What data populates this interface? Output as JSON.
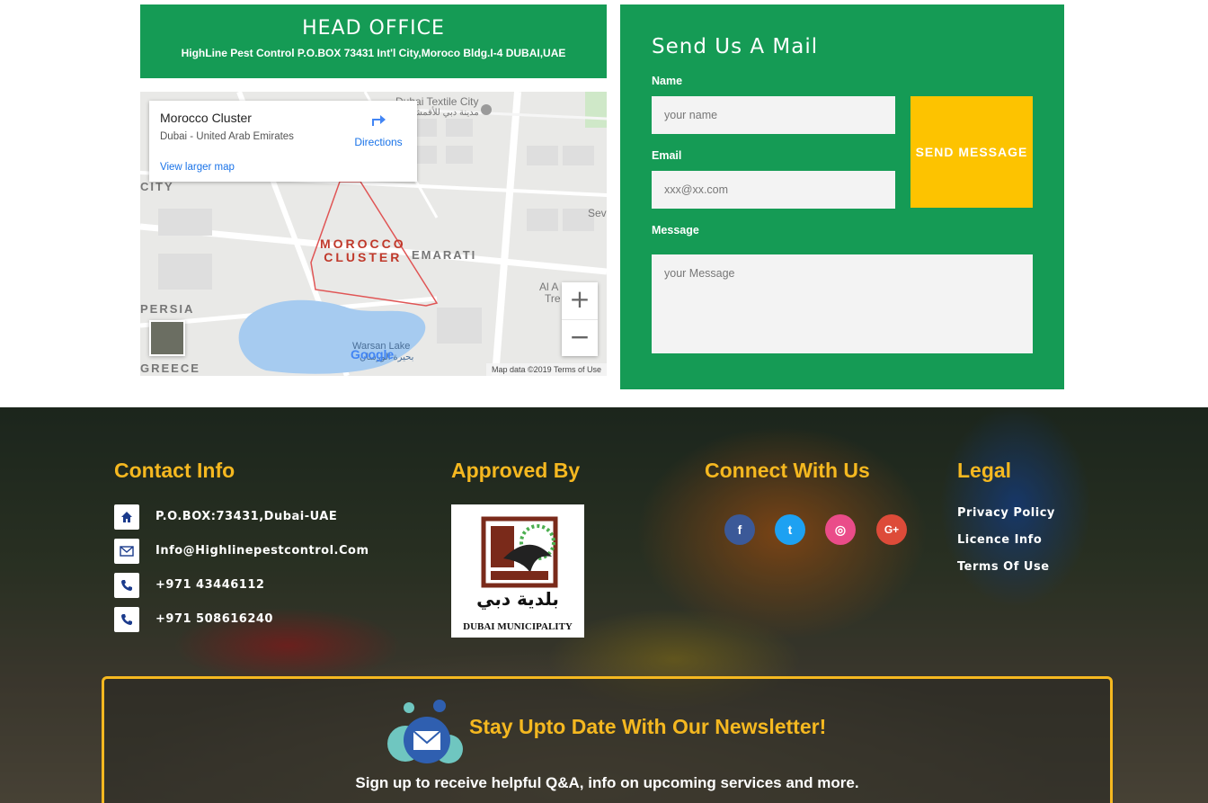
{
  "head_office": {
    "title": "HEAD OFFICE",
    "address": "HighLine Pest Control P.O.BOX 73431 Int'l City,Moroco Bldg.I-4 DUBAI,UAE"
  },
  "map": {
    "place_name": "Morocco Cluster",
    "place_sub": "Dubai - United Arab Emirates",
    "directions_label": "Directions",
    "larger_map_label": "View larger map",
    "labels": {
      "city": "CITY",
      "persia": "PERSIA",
      "greece": "GREECE",
      "emarati": "EMARATI",
      "textile": "Dubai Textile City",
      "textile_ar": "مدينة دبي للأقمشة",
      "warsan": "Warsan Lake",
      "warsan_ar": "بحيرة الورسان",
      "sev": "Sev",
      "al_a": "Al A",
      "tre": "Tre",
      "cluster_line1": "MOROCCO",
      "cluster_line2": "CLUSTER"
    },
    "zoom_in": "+",
    "zoom_out": "−",
    "google": "Google",
    "attribution": "Map data ©2019  Terms of Use"
  },
  "mail_form": {
    "title": "Send Us A Mail",
    "name_label": "Name",
    "name_placeholder": "your name",
    "email_label": "Email",
    "email_placeholder": "xxx@xx.com",
    "message_label": "Message",
    "message_placeholder": "your Message",
    "send_label": "SEND MESSAGE"
  },
  "footer": {
    "contact": {
      "heading": "Contact Info",
      "items": [
        {
          "icon": "home-icon",
          "text": "P.O.BOX:73431,Dubai-UAE"
        },
        {
          "icon": "envelope-icon",
          "text": "Info@Highlinepestcontrol.Com"
        },
        {
          "icon": "phone-icon",
          "text": "+971 43446112"
        },
        {
          "icon": "phone-icon",
          "text": "+971 508616240"
        }
      ]
    },
    "approved": {
      "heading": "Approved By",
      "logo_text": "DUBAI MUNICIPALITY",
      "logo_text_ar": "بلدية دبي"
    },
    "connect": {
      "heading": "Connect With Us",
      "networks": [
        {
          "name": "facebook",
          "glyph": "f",
          "color": "#3b5998"
        },
        {
          "name": "twitter",
          "glyph": "t",
          "color": "#1da1f2"
        },
        {
          "name": "dribbble",
          "glyph": "◎",
          "color": "#ea4c89"
        },
        {
          "name": "google-plus",
          "glyph": "G+",
          "color": "#dd4b39"
        }
      ]
    },
    "legal": {
      "heading": "Legal",
      "links": [
        "Privacy Policy",
        "Licence Info",
        "Terms Of Use"
      ]
    },
    "newsletter": {
      "title": "Stay Upto Date With Our Newsletter!",
      "subtitle": "Sign up to receive helpful Q&A, info on upcoming services and more."
    }
  },
  "colors": {
    "brand_green": "#159b55",
    "accent_yellow": "#fdc300",
    "heading_gold": "#f5b820"
  }
}
